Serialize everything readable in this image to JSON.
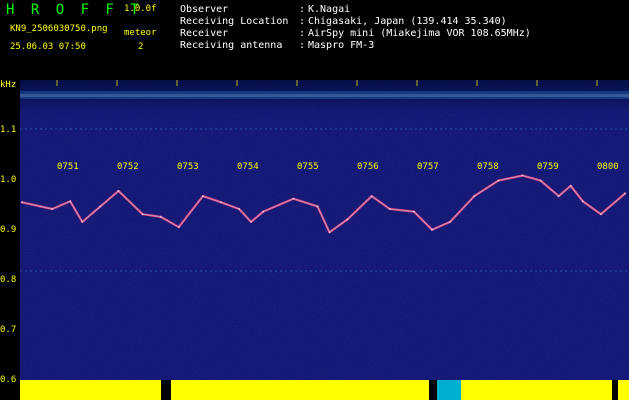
{
  "header": {
    "title": "H R O F F T",
    "version": "1.0.0f",
    "filename": "KN9_2506030750.png",
    "mode": "meteor",
    "count": "2",
    "datetime": "25.06.03 07:50"
  },
  "meta": {
    "observer": {
      "label": "Observer",
      "value": "K.Nagai"
    },
    "location": {
      "label": "Receiving Location",
      "value": "Chigasaki, Japan (139.414 35.340)"
    },
    "receiver": {
      "label": "Receiver",
      "value": "AirSpy mini (Miakejima VOR 108.65MHz)"
    },
    "antenna": {
      "label": "Receiving antenna",
      "value": "Maspro FM-3"
    }
  },
  "axis": {
    "unit": "kHz",
    "y_ticks": [
      "1.1",
      "1.0",
      "0.9",
      "0.8",
      "0.7",
      "0.6"
    ],
    "x_ticks": [
      "0751",
      "0752",
      "0753",
      "0754",
      "0755",
      "0756",
      "0757",
      "0758",
      "0759",
      "0800"
    ]
  },
  "colors": {
    "background": "#0a0d6a",
    "trace": "#ff3b7a",
    "accent": "#00ff00",
    "label": "#ffff00"
  },
  "chart_data": {
    "type": "line",
    "xlabel": "",
    "ylabel": "kHz",
    "x_ticks": [
      "0751",
      "0752",
      "0753",
      "0754",
      "0755",
      "0756",
      "0757",
      "0758",
      "0759",
      "0800"
    ],
    "y_ticks": [
      1.1,
      1.0,
      0.9,
      0.8,
      0.7,
      0.6
    ],
    "ylim": [
      0.6,
      1.15
    ],
    "series": [
      {
        "x": [
          0,
          0.05,
          0.08,
          0.1,
          0.13,
          0.16,
          0.2,
          0.23,
          0.26,
          0.3,
          0.33,
          0.36,
          0.38,
          0.4,
          0.45,
          0.49,
          0.51,
          0.54,
          0.58,
          0.61,
          0.65,
          0.68,
          0.71,
          0.75,
          0.79,
          0.83,
          0.86,
          0.89,
          0.91,
          0.93,
          0.96,
          1.0
        ],
        "y": [
          0.948,
          0.935,
          0.95,
          0.91,
          0.94,
          0.97,
          0.925,
          0.92,
          0.9,
          0.96,
          0.948,
          0.935,
          0.91,
          0.93,
          0.955,
          0.94,
          0.89,
          0.915,
          0.96,
          0.935,
          0.93,
          0.895,
          0.91,
          0.96,
          0.99,
          1.0,
          0.99,
          0.96,
          0.98,
          0.95,
          0.925,
          0.965
        ]
      }
    ]
  }
}
